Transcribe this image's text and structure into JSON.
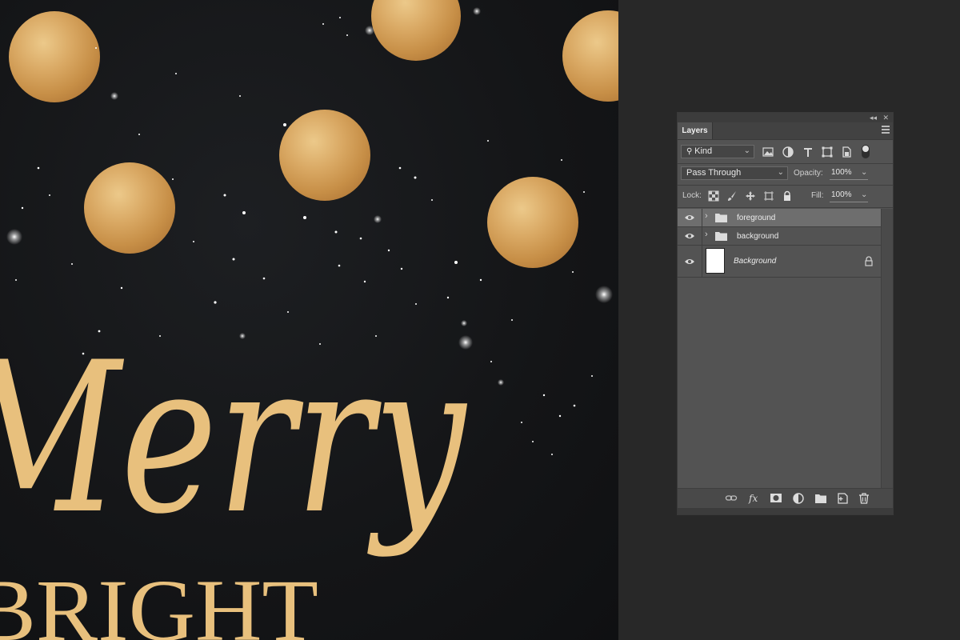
{
  "canvas": {
    "text_line1": "Merry",
    "text_line2": "BRIGHT",
    "colors": {
      "gold": "#e8c07d",
      "night": "#141517"
    }
  },
  "layers_panel": {
    "tab_label": "Layers",
    "filter": {
      "kind_label": "Kind"
    },
    "blend_mode": "Pass Through",
    "opacity_label": "Opacity:",
    "opacity_value": "100%",
    "lock_label": "Lock:",
    "fill_label": "Fill:",
    "fill_value": "100%",
    "layers": [
      {
        "name": "foreground",
        "type": "group",
        "visible": true,
        "selected": true
      },
      {
        "name": "background",
        "type": "group",
        "visible": true,
        "selected": false
      },
      {
        "name": "Background",
        "type": "pixel",
        "visible": true,
        "locked": true
      }
    ],
    "footer_icons": [
      "link-layers-icon",
      "fx-icon",
      "add-mask-icon",
      "adjustment-layer-icon",
      "new-group-icon",
      "new-layer-icon",
      "delete-layer-icon"
    ]
  }
}
